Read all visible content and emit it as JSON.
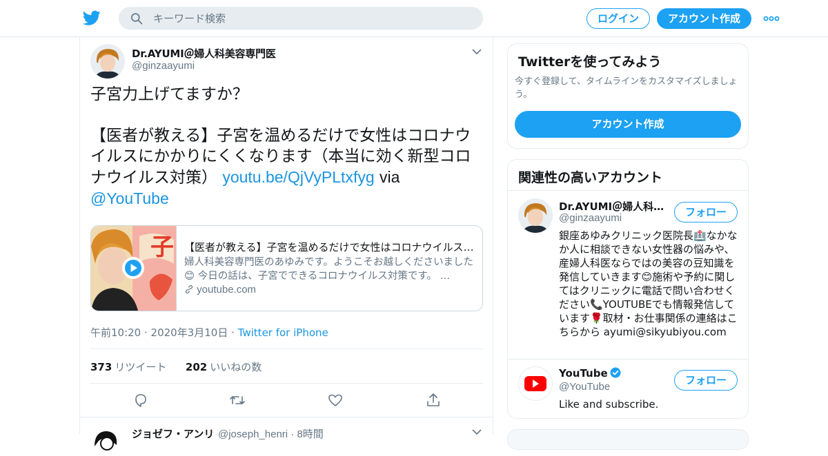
{
  "topbar": {
    "search_placeholder": "キーワード検索",
    "login_label": "ログイン",
    "signup_label": "アカウント作成"
  },
  "tweet": {
    "author_name": "Dr.AYUMI＠婦人科美容専門医",
    "author_handle": "@ginzaayumi",
    "text_line1": "子宮力上げてますか？",
    "text_body": "【医者が教える】子宮を温めるだけで女性はコロナウイルスにかかりにくくなります（本当に効く新型コロナウイルス対策）",
    "link_text": "youtu.be/QjVyPLtxfyg",
    "via_text": "via",
    "mention": "@YouTube",
    "card": {
      "title": "【医者が教える】子宮を温めるだけで女性はコロナウイルスにかかりにくくなります（本当に効く新型コロナウイルス対策）",
      "description": "婦人科美容専門医のあゆみです。ようこそお越しくださいました😊 今日の話は、子宮でできるコロナウイルス対策です。 …",
      "domain": "youtube.com"
    },
    "timestamp": "午前10:20 · 2020年3月10日",
    "separator": "·",
    "source": "Twitter for iPhone",
    "retweet_count": "373",
    "retweet_label": "リツイート",
    "like_count": "202",
    "like_label": "いいねの数"
  },
  "reply": {
    "name": "ジョゼフ・アンリ",
    "handle_time": "@joseph_henri · 8時間"
  },
  "sidebar": {
    "try_title": "Twitterを使ってみよう",
    "try_sub": "今すぐ登録して、タイムラインをカスタマイズしましょう。",
    "try_button": "アカウント作成",
    "related_title": "関連性の高いアカウント",
    "accounts": [
      {
        "name": "Dr.AYUMI＠婦人科…",
        "handle": "@ginzaayumi",
        "follow": "フォロー",
        "bio": "銀座あゆみクリニック医院長🏥なかなか人に相談できない女性器の悩みや、産婦人科医ならではの美容の豆知識を発信していきます😊施術や予約に関してはクリニックに電話で問い合わせください📞YOUTUBEでも情報発信しています🌹取材・お仕事関係の連絡はこちらから ayumi@sikyubiyou.com"
      },
      {
        "name": "YouTube",
        "handle": "@YouTube",
        "follow": "フォロー",
        "bio": "Like and subscribe."
      }
    ]
  },
  "colors": {
    "brand": "#1da1f2",
    "link": "#1b95e0",
    "muted": "#657786",
    "youtube_red": "#ff0000"
  },
  "icons": [
    "twitter-bird-icon",
    "search-icon",
    "more-dots-icon",
    "chevron-down-icon",
    "play-icon",
    "link-icon",
    "reply-icon",
    "retweet-icon",
    "like-icon",
    "share-icon",
    "verified-icon",
    "youtube-logo-icon"
  ]
}
